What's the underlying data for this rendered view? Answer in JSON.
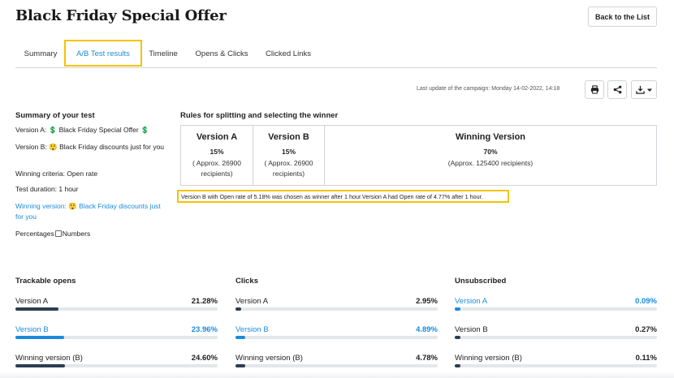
{
  "page": {
    "title": "Black Friday Special Offer",
    "back_button": "Back to the List"
  },
  "tabs": [
    {
      "label": "Summary"
    },
    {
      "label": "A/B Test results"
    },
    {
      "label": "Timeline"
    },
    {
      "label": "Opens & Clicks"
    },
    {
      "label": "Clicked Links"
    }
  ],
  "active_tab": "A/B Test results",
  "toolbar": {
    "last_update_label": "Last update of the campaign:",
    "last_update_value": "Monday 14-02-2022, 14:18",
    "icons": [
      "print-icon",
      "share-icon",
      "download-icon",
      "chevron-down-icon"
    ]
  },
  "summary": {
    "title": "Summary of your test",
    "version_a_prefix": "Version A:",
    "version_a_value": "💲 Black Friday Special Offer 💲",
    "version_b_prefix": "Version B:",
    "version_b_value": "😲 Black Friday discounts just for you",
    "criteria": "Winning criteria: Open rate",
    "duration": "Test duration: 1 hour",
    "winner_prefix": "Winning version:",
    "winner_value": "😲 Black Friday discounts just for you",
    "percentages_label": "Percentages",
    "numbers_label": "Numbers"
  },
  "rules": {
    "title": "Rules for splitting and selecting the winner",
    "columns": [
      {
        "name": "Version A",
        "percent": "15%",
        "desc1": "( Approx. 26900",
        "desc2": "recipients)"
      },
      {
        "name": "Version B",
        "percent": "15%",
        "desc1": "( Approx. 26900",
        "desc2": "recipients)"
      },
      {
        "name": "Winning Version",
        "percent": "70%",
        "desc1": "(Approx. 125400 recipients)",
        "desc2": ""
      }
    ],
    "result_text": "Version B with Open rate of 5.18% was chosen as winner after 1 hour.Version A had Open rate of 4.77% after 1 hour."
  },
  "stats": [
    {
      "title": "Trackable opens",
      "rows": [
        {
          "label": "Version A",
          "value": "21.28%",
          "fraction": 0.2128,
          "highlight": false
        },
        {
          "label": "Version B",
          "value": "23.96%",
          "fraction": 0.2396,
          "highlight": true
        },
        {
          "label": "Winning version (B)",
          "value": "24.60%",
          "fraction": 0.246,
          "highlight": false
        }
      ]
    },
    {
      "title": "Clicks",
      "rows": [
        {
          "label": "Version A",
          "value": "2.95%",
          "fraction": 0.0295,
          "highlight": false
        },
        {
          "label": "Version B",
          "value": "4.89%",
          "fraction": 0.0489,
          "highlight": true
        },
        {
          "label": "Winning version (B)",
          "value": "4.78%",
          "fraction": 0.0478,
          "highlight": false
        }
      ]
    },
    {
      "title": "Unsubscribed",
      "rows": [
        {
          "label": "Version A",
          "value": "0.09%",
          "fraction": 0.0009,
          "highlight": true
        },
        {
          "label": "Version B",
          "value": "0.27%",
          "fraction": 0.0027,
          "highlight": false
        },
        {
          "label": "Winning version (B)",
          "value": "0.11%",
          "fraction": 0.0011,
          "highlight": false
        }
      ]
    }
  ],
  "colors": {
    "accent": "#1a8bdc",
    "highlight": "#f4c400",
    "bar_dark": "#2c3e52"
  }
}
